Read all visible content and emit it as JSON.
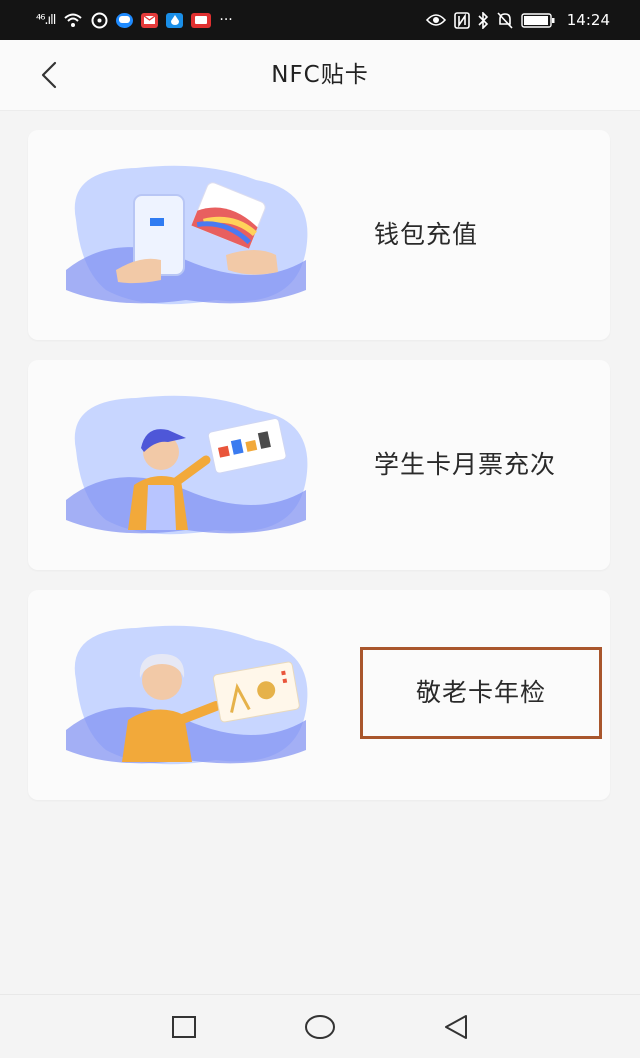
{
  "status_bar": {
    "signal_text": "⁴⁶.ıll",
    "notification_icons": [
      "wifi-icon",
      "music-icon",
      "message-icon",
      "mail-icon",
      "app-icon",
      "video-icon"
    ],
    "more": "···",
    "system_icons": [
      "eye-icon",
      "nfc-icon",
      "bluetooth-icon",
      "mute-icon",
      "battery-icon"
    ],
    "time": "14:24"
  },
  "header": {
    "title": "NFC贴卡"
  },
  "cards": [
    {
      "label": "钱包充值",
      "illustration": "wallet-recharge-illustration"
    },
    {
      "label": "学生卡月票充次",
      "illustration": "student-card-illustration"
    },
    {
      "label": "敬老卡年检",
      "illustration": "senior-card-illustration",
      "highlighted": true
    }
  ],
  "colors": {
    "blob_light": "#cfdcff",
    "blob_mid": "#7d8ef2",
    "blob_dark": "#4e57d8",
    "highlight_border": "#a9562c"
  },
  "nav_bar": {
    "buttons": [
      "recent-apps-icon",
      "home-icon",
      "back-triangle-icon"
    ]
  }
}
